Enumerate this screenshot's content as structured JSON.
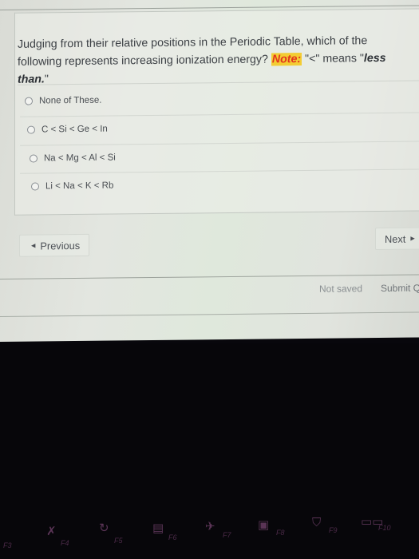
{
  "question": {
    "text_before_note": "Judging from their relative positions in the Periodic Table, which of the following represents increasing ionization energy? ",
    "note_label": "Note:",
    "text_after_note": " \"<\" means \"",
    "emphasis": "less than.",
    "closing_quote": "\""
  },
  "answers": [
    {
      "label": "None of These.",
      "selected": false
    },
    {
      "label": "C < Si < Ge <  In",
      "selected": false
    },
    {
      "label": "Na < Mg < Al < Si",
      "selected": false
    },
    {
      "label": "Li < Na < K < Rb",
      "selected": false
    }
  ],
  "navigation": {
    "previous_label": "Previous",
    "previous_icon": "triangle-left-icon",
    "next_label": "Next",
    "next_icon": "triangle-right-icon"
  },
  "footer": {
    "save_status": "Not saved",
    "submit_label": "Submit Q"
  },
  "colors": {
    "note_highlight": "#f3cc33",
    "note_text": "#e2361d"
  },
  "keyboard": {
    "keys": [
      {
        "label": "F3",
        "icon": "volume-icon"
      },
      {
        "label": "F4",
        "icon": "mic-mute-icon"
      },
      {
        "label": "F5",
        "icon": "refresh-icon"
      },
      {
        "label": "F6",
        "icon": "touchpad-off-icon"
      },
      {
        "label": "F7",
        "icon": "airplane-mode-icon"
      },
      {
        "label": "F8",
        "icon": "camera-off-icon"
      },
      {
        "label": "F9",
        "icon": "lock-icon"
      },
      {
        "label": "F10",
        "icon": "display-switch-icon"
      }
    ]
  }
}
